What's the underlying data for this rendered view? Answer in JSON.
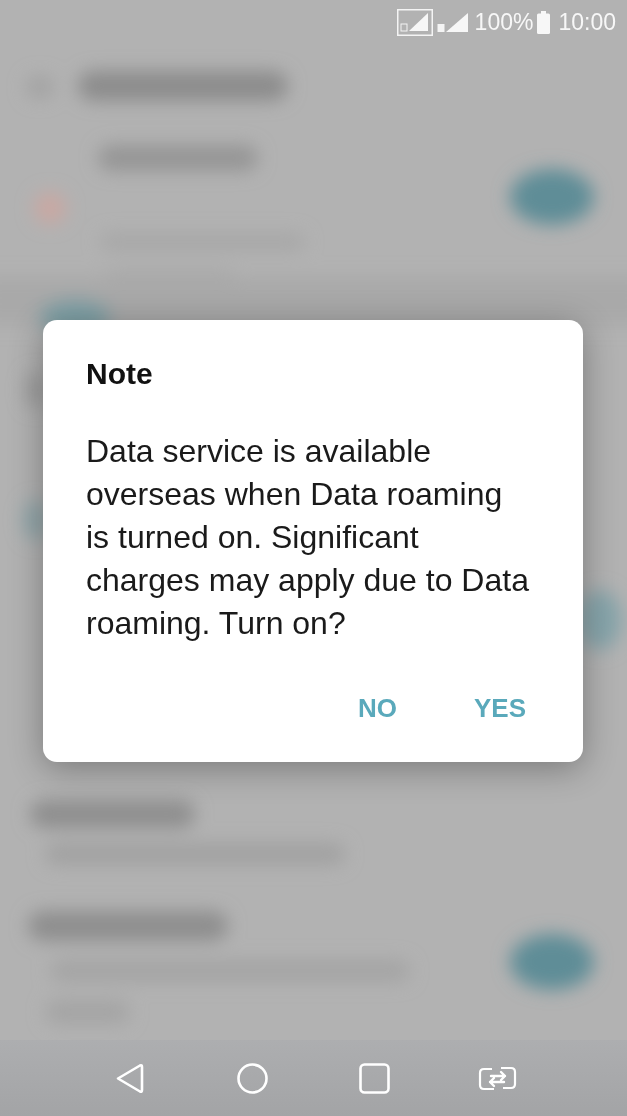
{
  "status_bar": {
    "battery": "100%",
    "time": "10:00"
  },
  "dialog": {
    "title": "Note",
    "message": "Data service is available overseas when Data roaming is turned on. Significant charges may apply due to Data roaming. Turn on?",
    "buttons": [
      "NO",
      "YES"
    ]
  }
}
